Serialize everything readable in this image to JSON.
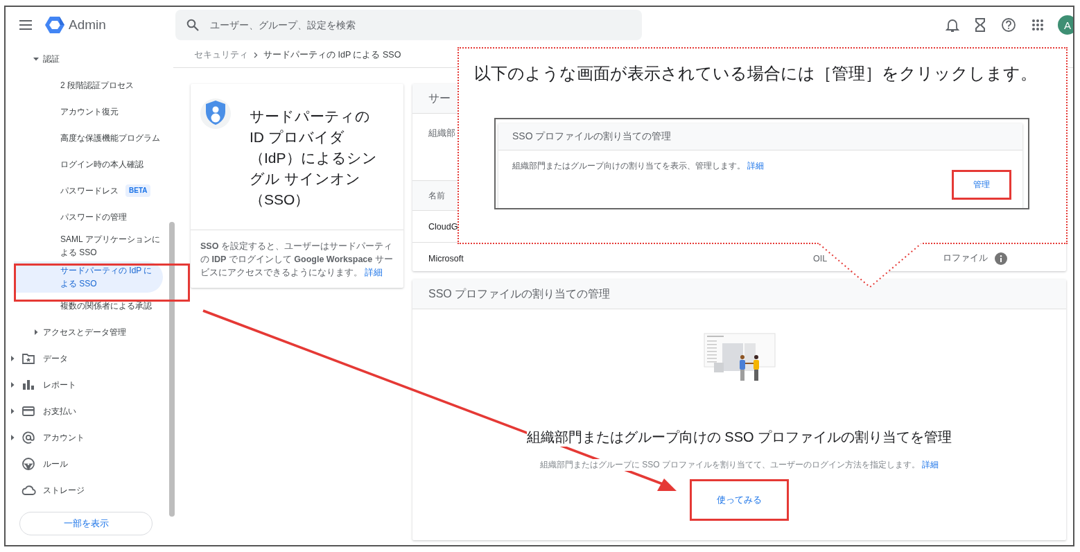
{
  "topbar": {
    "product": "Admin",
    "search": {
      "placeholder": "ユーザー、グループ、設定を検索"
    },
    "avatar": "A"
  },
  "sidebar": {
    "section_items": [
      {
        "label": "認証",
        "expanded": true,
        "children": [
          {
            "label": "2 段階認証プロセス",
            "selected": false
          },
          {
            "label": "アカウント復元",
            "selected": false
          },
          {
            "label": "高度な保護機能プログラム",
            "selected": false
          },
          {
            "label": "ログイン時の本人確認",
            "selected": false
          },
          {
            "label": "パスワードレス",
            "badge": "BETA",
            "selected": false
          },
          {
            "label": "パスワードの管理",
            "selected": false
          },
          {
            "label": "SAML アプリケーションによる SSO",
            "selected": false
          },
          {
            "label": "サードパーティの IdP による SSO",
            "selected": true
          },
          {
            "label": "複数の関係者による承認",
            "selected": false
          }
        ]
      },
      {
        "label": "アクセスとデータ管理",
        "expanded": false
      }
    ],
    "nav_items": [
      {
        "label": "データ",
        "expandable": true
      },
      {
        "label": "レポート",
        "expandable": true
      },
      {
        "label": "お支払い",
        "expandable": true
      },
      {
        "label": "アカウント",
        "expandable": true
      },
      {
        "label": "ルール",
        "expandable": false
      },
      {
        "label": "ストレージ",
        "expandable": false
      }
    ],
    "show_less_button": "一部を表示"
  },
  "breadcrumb": [
    "セキュリティ",
    "サードパーティの IdP による SSO"
  ],
  "info_card": {
    "title": "サードパーティの ID プロバイダ（IdP）によるシングル サインオン（SSO）",
    "description": "**SSO** を設定すると、ユーザーはサードパーティの **IDP** でログインして **Google Workspace** サービスにアクセスできるようになります。",
    "link": "詳細"
  },
  "profiles_card": {
    "title": "サー",
    "description": "組織部",
    "columns": [
      "名前"
    ],
    "rows": [
      {
        "cells": [
          "CloudG"
        ],
        "info": false
      },
      {
        "cells": [
          "Microsoft",
          "OIL",
          "ロファイル"
        ],
        "info": true
      }
    ]
  },
  "assignment_card": {
    "title": "SSO プロファイルの割り当ての管理",
    "heading": "組織部門またはグループ向けの SSO プロファイルの割り当てを管理",
    "description": "組織部門またはグループに SSO プロファイルを割り当てて、ユーザーのログイン方法を指定します。",
    "link": "詳細",
    "button": "使ってみる"
  },
  "callout": {
    "text": "以下のような画面が表示されている場合には［管理］をクリックします。",
    "inset": {
      "title": "SSO プロファイルの割り当ての管理",
      "description": "組織部門またはグループ向けの割り当てを表示、管理します。",
      "link": "詳細",
      "button": "管理"
    }
  }
}
